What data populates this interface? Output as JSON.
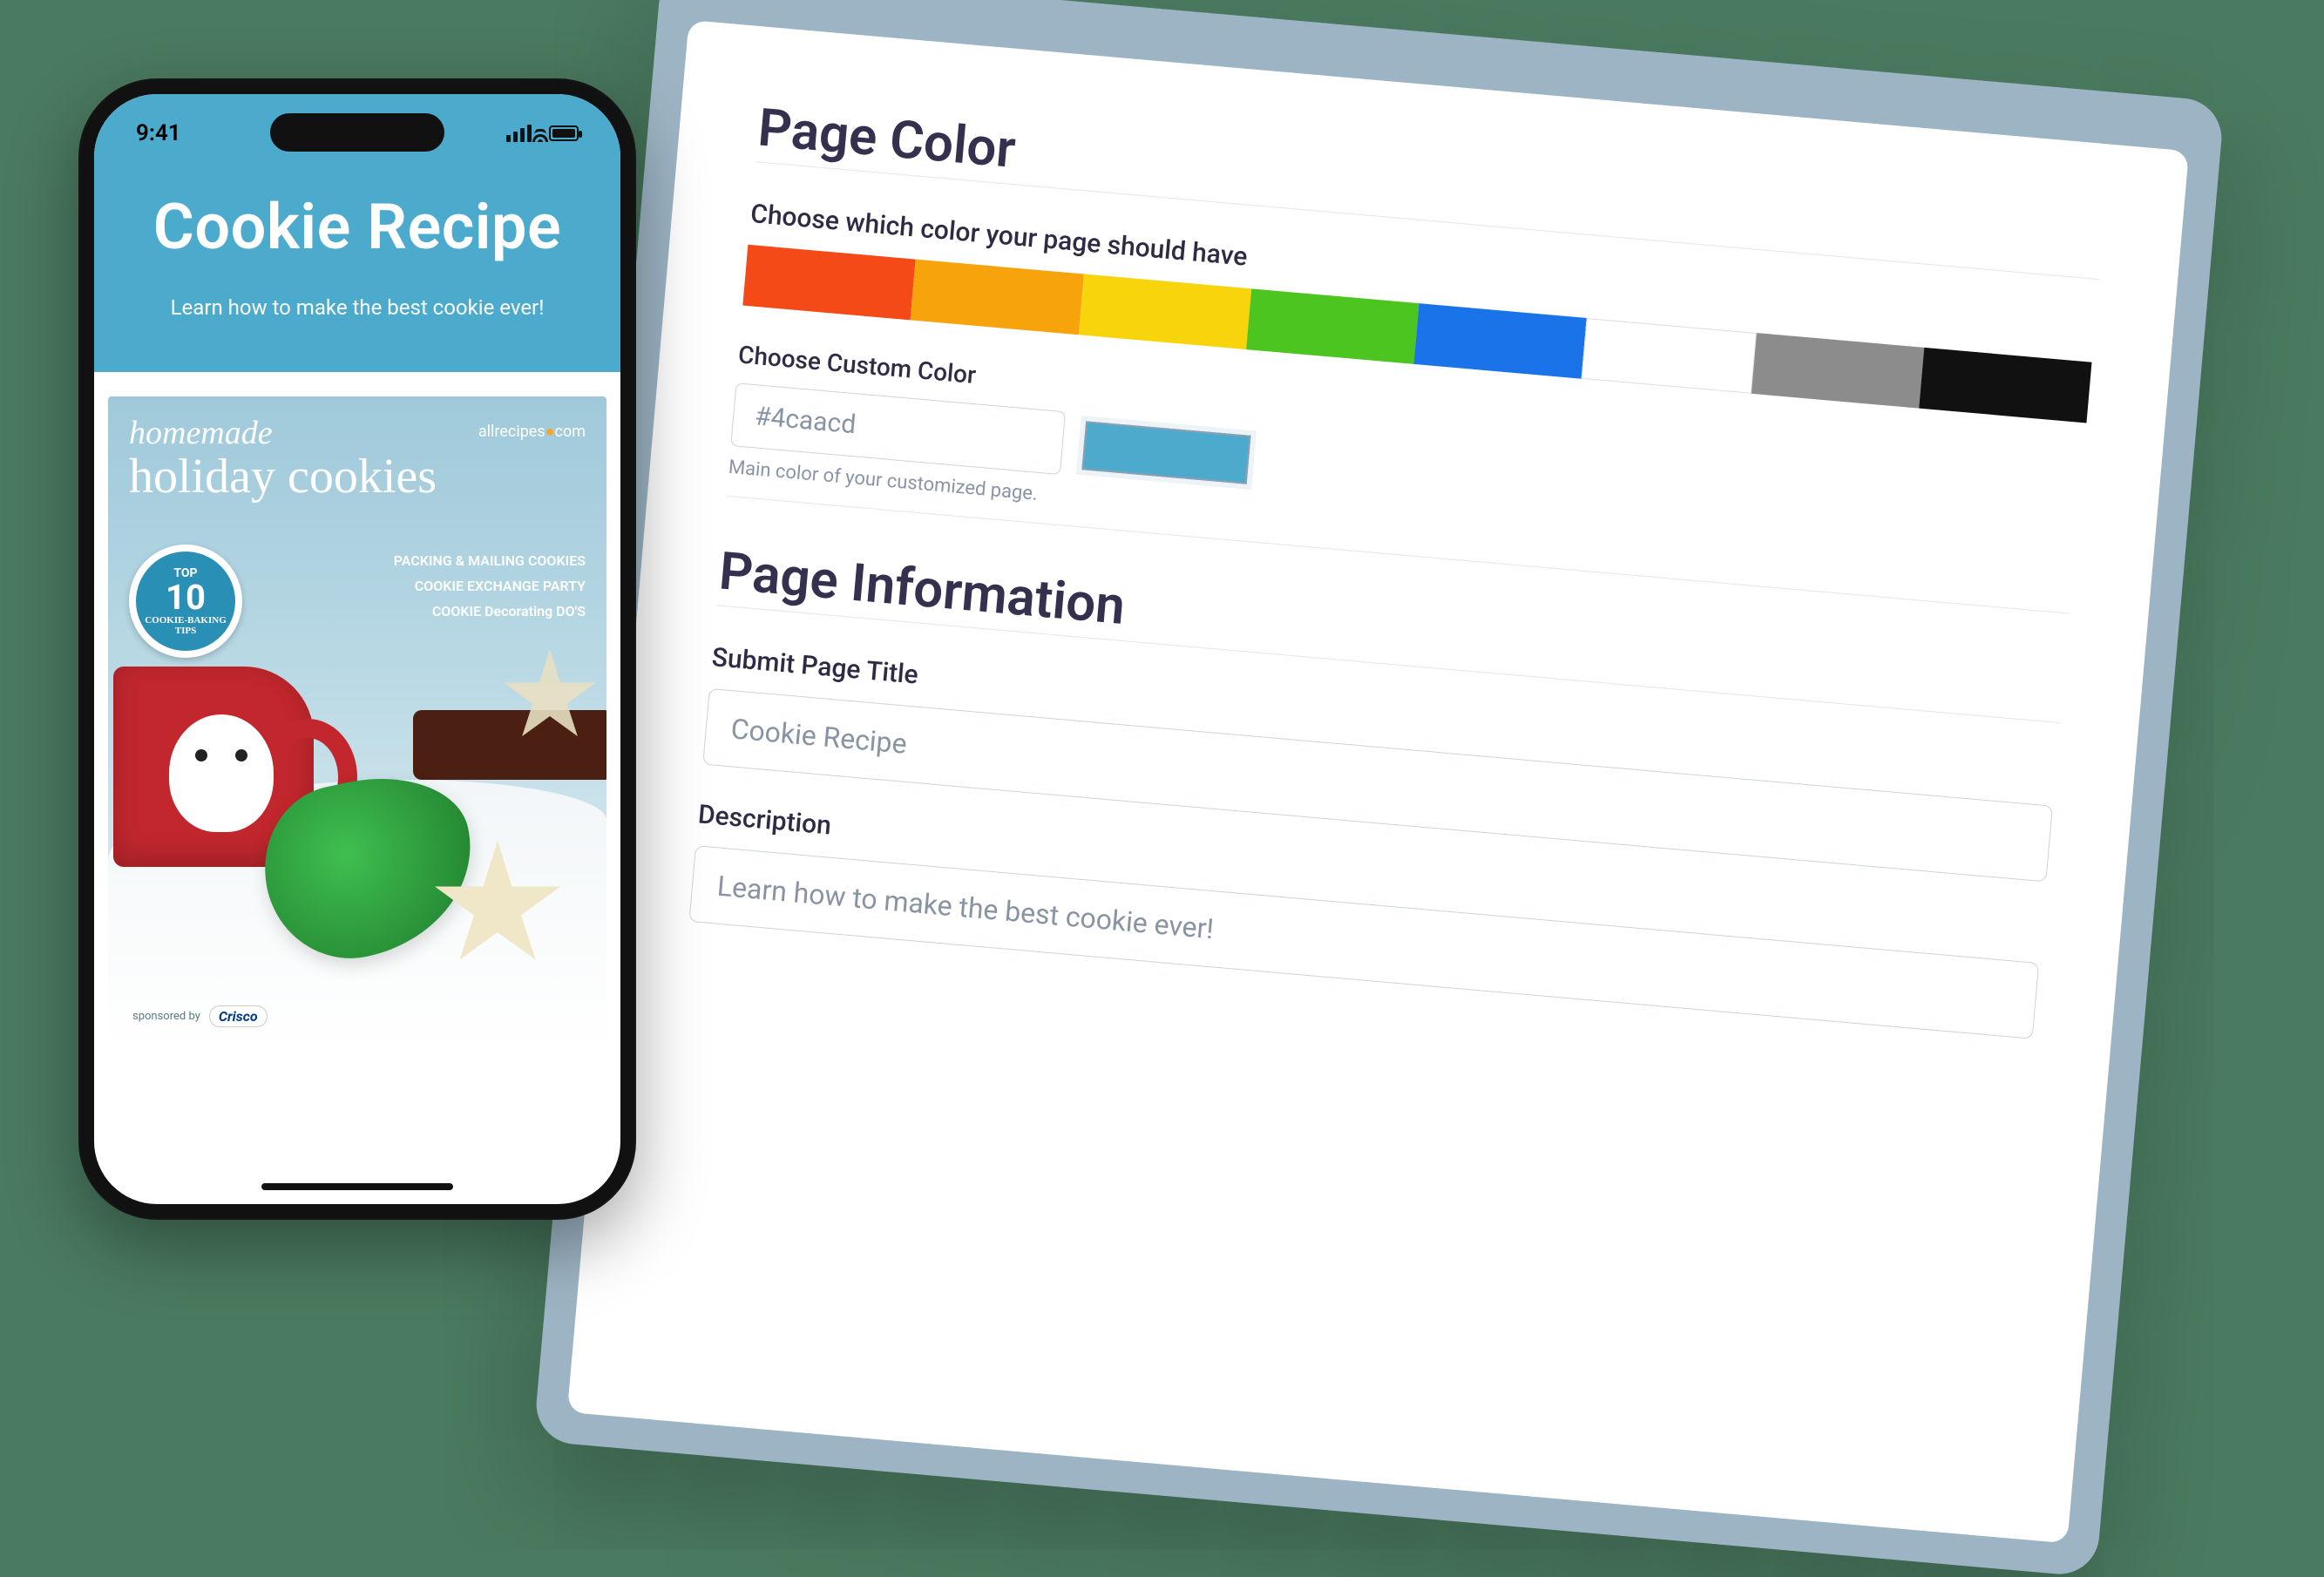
{
  "phone": {
    "status_time": "9:41",
    "title": "Cookie Recipe",
    "subtitle": "Learn how to make the best cookie ever!",
    "hero": {
      "line1": "homemade",
      "line2": "holiday cookies",
      "brand": "allrecipes",
      "brand_suffix": "com",
      "badge_top": "TOP",
      "badge_num": "10",
      "badge_bottom": "COOKIE-BAKING TIPS",
      "list1": "PACKING & MAILING COOKIES",
      "list2": "COOKIE EXCHANGE PARTY",
      "list3": "COOKIE Decorating DO'S",
      "sponsor_label": "sponsored by",
      "sponsor_name": "Crisco"
    }
  },
  "panel": {
    "section_color_title": "Page Color",
    "choose_color_label": "Choose which color your page should have",
    "swatches": [
      "#f44a17",
      "#f7a30b",
      "#f7d40b",
      "#4cc520",
      "#1a73e8",
      "#ffffff",
      "#8c8c8c",
      "#111111"
    ],
    "custom_color_label": "Choose Custom Color",
    "custom_color_value": "#4caacd",
    "custom_color_help": "Main color of your customized page.",
    "section_info_title": "Page Information",
    "page_title_label": "Submit Page Title",
    "page_title_value": "Cookie Recipe",
    "description_label": "Description",
    "description_value": "Learn how to make the best cookie ever!"
  }
}
